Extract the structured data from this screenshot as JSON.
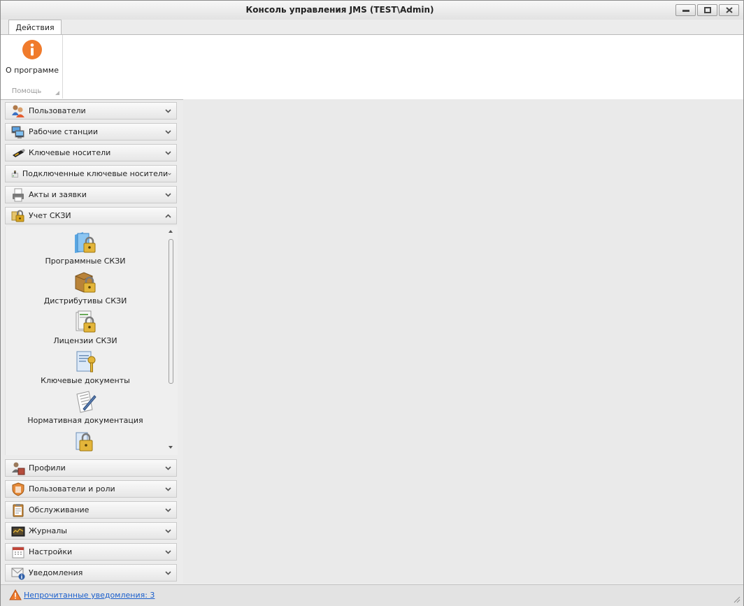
{
  "window": {
    "title": "Консоль управления JMS (TEST\\Admin)"
  },
  "ribbon": {
    "tab_label": "Действия",
    "about_label": "О программе",
    "group_label": "Помощь"
  },
  "nav": {
    "sections_top": [
      {
        "label": "Пользователи",
        "icon": "users-icon"
      },
      {
        "label": "Рабочие станции",
        "icon": "workstations-icon"
      },
      {
        "label": "Ключевые носители",
        "icon": "usb-key-icon"
      },
      {
        "label": "Подключенные ключевые носители",
        "icon": "connected-key-icon"
      },
      {
        "label": "Акты и заявки",
        "icon": "printer-docs-icon"
      },
      {
        "label": "Учет СКЗИ",
        "icon": "lock-folder-icon",
        "expanded": true
      }
    ],
    "skzi_items": [
      {
        "label": "Программные СКЗИ",
        "icon": "folder-lock-icon"
      },
      {
        "label": "Дистрибутивы СКЗИ",
        "icon": "box-lock-icon"
      },
      {
        "label": "Лицензии СКЗИ",
        "icon": "license-lock-icon"
      },
      {
        "label": "Ключевые документы",
        "icon": "key-document-icon"
      },
      {
        "label": "Нормативная документация",
        "icon": "regulatory-doc-icon"
      },
      {
        "label": "",
        "icon": "docs-lock-icon"
      }
    ],
    "sections_bottom": [
      {
        "label": "Профили",
        "icon": "profiles-icon"
      },
      {
        "label": "Пользователи и роли",
        "icon": "roles-shield-icon"
      },
      {
        "label": "Обслуживание",
        "icon": "clipboard-icon"
      },
      {
        "label": "Журналы",
        "icon": "journal-icon"
      },
      {
        "label": "Настройки",
        "icon": "settings-calendar-icon"
      },
      {
        "label": "Уведомления",
        "icon": "envelope-icon"
      }
    ]
  },
  "status": {
    "notifications_text": "Непрочитанные уведомления: 3"
  },
  "colors": {
    "accent_orange": "#f07b2c",
    "link_blue": "#1b5fcc",
    "lock_gold": "#d8a521"
  }
}
